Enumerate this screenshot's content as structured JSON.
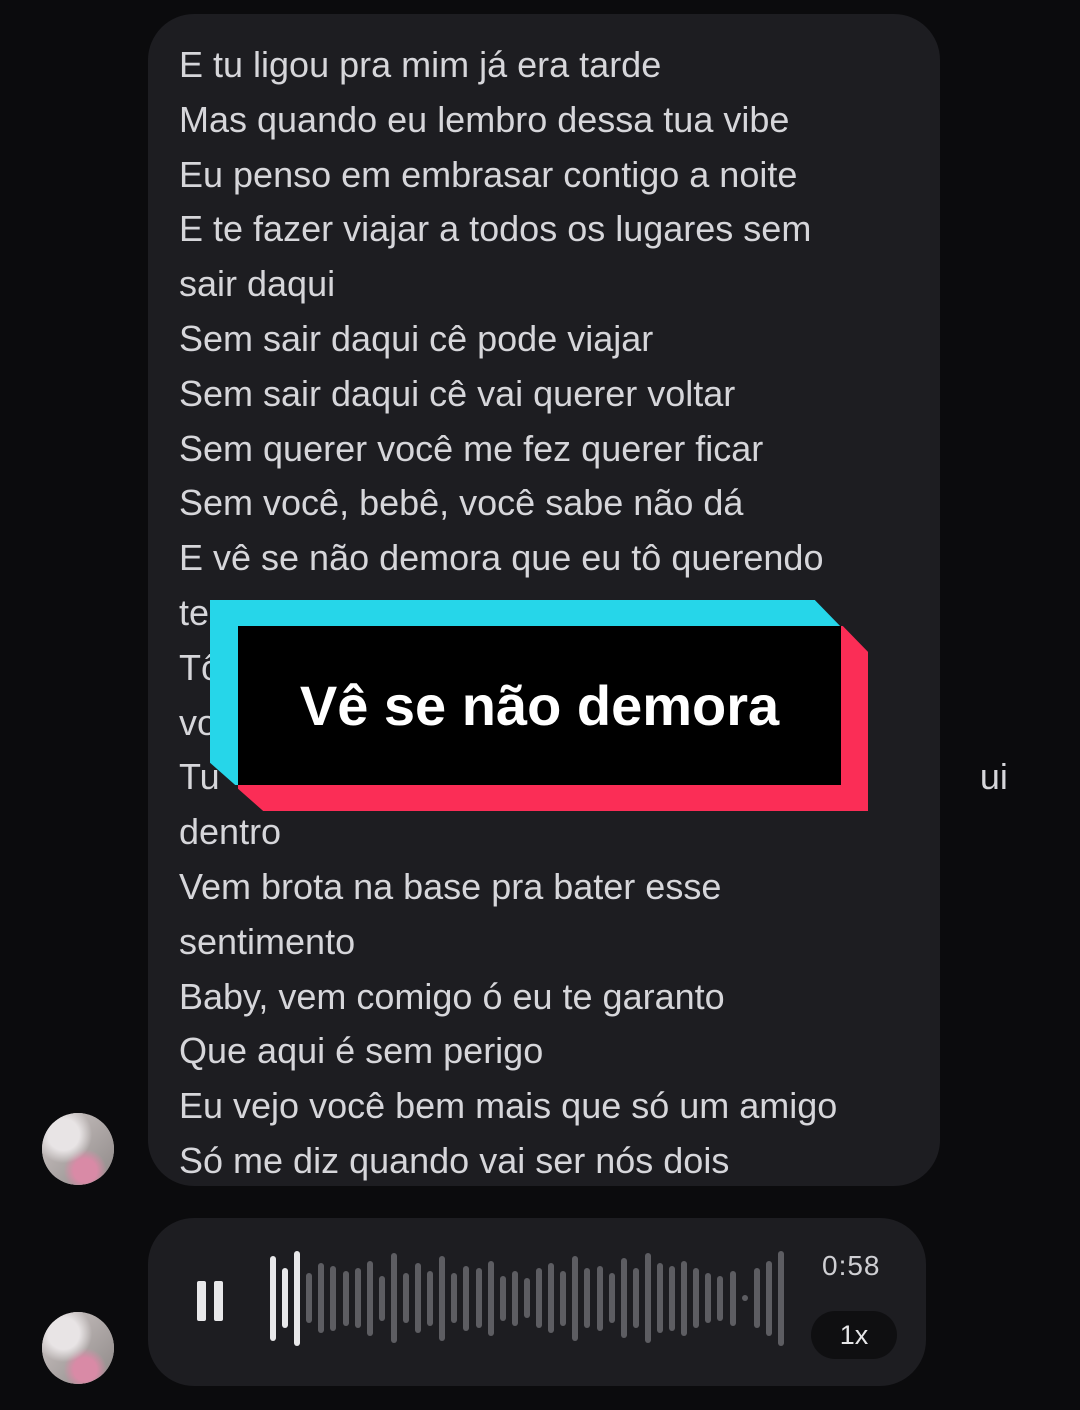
{
  "message": {
    "lyrics": [
      "E tu ligou pra mim já era tarde",
      "Mas quando eu lembro dessa tua vibe",
      "Eu penso em embrasar contigo a noite",
      "E te fazer viajar a todos os lugares sem",
      "sair daqui",
      "Sem sair daqui cê pode viajar",
      "Sem sair daqui cê vai querer voltar",
      "Sem querer você me fez querer ficar",
      "Sem você, bebê, você sabe não dá",
      "E vê se não demora que eu tô querendo",
      "te ver",
      "Tô",
      "vo",
      "Tu                                                                            ui",
      "dentro",
      "Vem brota na base pra bater esse",
      "sentimento",
      "Baby, vem comigo ó eu te garanto",
      "Que aqui é sem perigo",
      "Eu vejo você bem mais que só um amigo",
      "Só me diz quando vai ser nós dois"
    ]
  },
  "overlay": {
    "caption": "Vê se não demora"
  },
  "audio": {
    "duration": "0:58",
    "speed": "1x",
    "waveform_levels": [
      0.85,
      0.6,
      0.95,
      0.5,
      0.7,
      0.65,
      0.55,
      0.6,
      0.75,
      0.45,
      0.9,
      0.5,
      0.7,
      0.55,
      0.85,
      0.5,
      0.65,
      0.6,
      0.75,
      0.45,
      0.55,
      0.4,
      0.6,
      0.7,
      0.55,
      0.85,
      0.6,
      0.65,
      0.5,
      0.8,
      0.6,
      0.9,
      0.7,
      0.65,
      0.75,
      0.6,
      0.5,
      0.45,
      0.55,
      0.04,
      0.6,
      0.75,
      0.95
    ],
    "played_fraction": 0.06
  },
  "colors": {
    "background": "#0b0b0d",
    "bubble": "#1d1d21",
    "caption_cyan": "#26d6e9",
    "caption_red": "#fb2d56",
    "wave_played": "#e8e8ea",
    "wave_unplayed": "#5d5d62"
  }
}
